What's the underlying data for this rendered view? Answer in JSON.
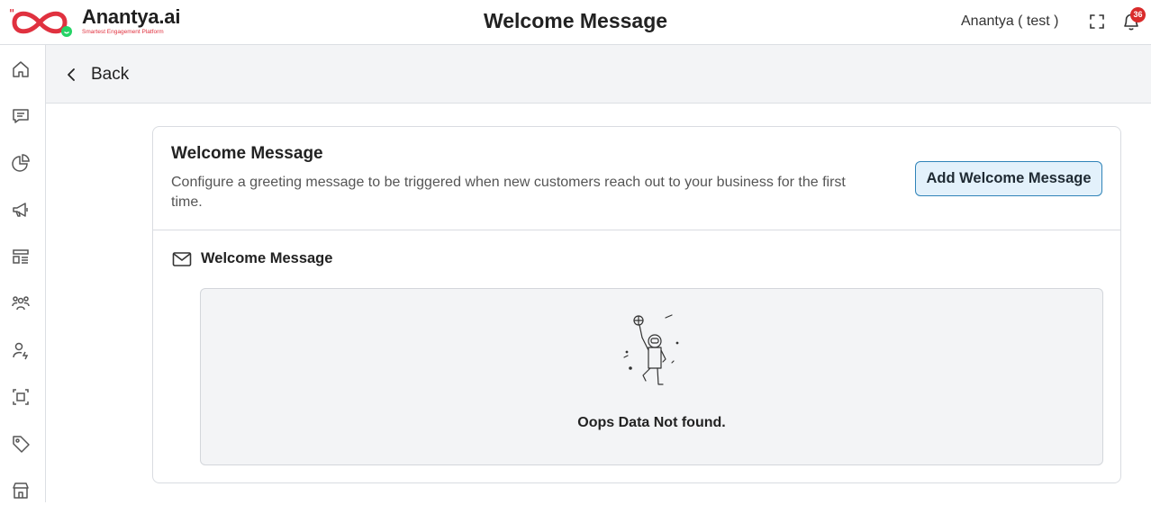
{
  "header": {
    "brand_name": "Anantya.ai",
    "tagline": "Smartest Engagement Platform",
    "page_title": "Welcome Message",
    "user_name": "Anantya ( test )",
    "notification_count": "36",
    "brand_color": "#e0313f",
    "badge_color": "#d92b2b"
  },
  "sidebar": {
    "items": [
      {
        "icon": "home-icon"
      },
      {
        "icon": "chat-icon"
      },
      {
        "icon": "pie-chart-icon"
      },
      {
        "icon": "megaphone-icon"
      },
      {
        "icon": "template-icon"
      },
      {
        "icon": "users-group-icon"
      },
      {
        "icon": "user-bolt-icon"
      },
      {
        "icon": "focus-icon"
      },
      {
        "icon": "tag-icon"
      },
      {
        "icon": "store-icon"
      }
    ]
  },
  "backbar": {
    "back_label": "Back"
  },
  "card": {
    "title": "Welcome Message",
    "description": "Configure a greeting message to be triggered when new customers reach out to your business for the first time.",
    "add_button_label": "Add Welcome Message",
    "section_label": "Welcome Message",
    "empty_text": "Oops Data Not found.",
    "button_border_color": "#2f83b8",
    "button_bg_color": "#e3f1fb"
  }
}
